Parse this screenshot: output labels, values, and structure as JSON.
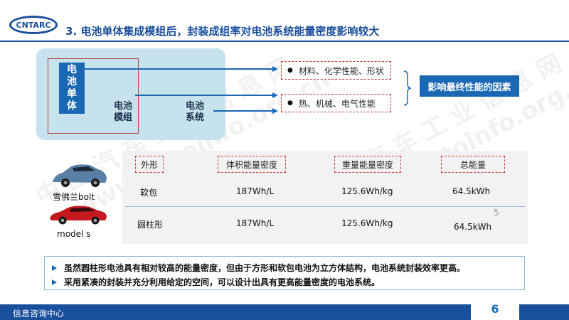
{
  "header": {
    "logo_text": "CNTARC",
    "title": "3. 电池单体集成模组后，封装成组率对电池系统能量密度影响较大"
  },
  "diagram": {
    "cell_chars": [
      "电",
      "池",
      "单",
      "体"
    ],
    "module_label_lines": [
      "电池",
      "模组"
    ],
    "system_label_lines": [
      "电池",
      "系统"
    ],
    "properties": [
      "材料、化学性能、形状",
      "热、机械、电气性能"
    ],
    "bullet": "●",
    "result": "影响最终性能的因素"
  },
  "table": {
    "headers": [
      "外形",
      "体积能量密度",
      "重量能量密度",
      "总能量"
    ],
    "rows": [
      {
        "car": "雪佛兰bolt",
        "shape": "软包",
        "volumetric": "187Wh/L",
        "gravimetric": "125.6Wh/kg",
        "total": "64.5kWh"
      },
      {
        "car": "model s",
        "shape": "圆柱形",
        "volumetric": "187Wh/L",
        "gravimetric": "125.6Wh/kg",
        "total": "64.5kWh"
      }
    ],
    "stray_mark": "5"
  },
  "notes": [
    "虽然圆柱形电池具有相对较高的能量密度，但由于方形和软包电池为立方体结构，电池系统封装效率更高。",
    "采用紧凑的封装并充分利用给定的空间，可以设计出具有更高能量密度的电池系统。"
  ],
  "footer": {
    "text": "信息咨询中心",
    "page_number": "6"
  },
  "watermark": {
    "line1": "中 国 汽 车 工 业 信 息 网",
    "line2": "www.autoinfo.org.cn"
  },
  "colors": {
    "brand_blue": "#1a4f9c",
    "accent_blue": "#1a68b4",
    "dashed_red": "#c43a3a",
    "panel_blue": "#c6e2ec"
  }
}
